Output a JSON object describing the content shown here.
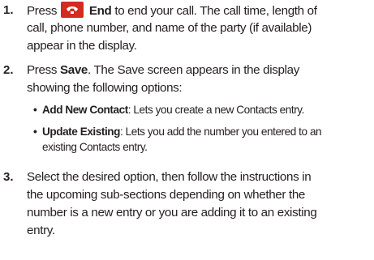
{
  "steps": [
    {
      "number": "1.",
      "icon": "end-call-icon",
      "line1_pre": "Press",
      "line1_bold": "End",
      "line1_post": "to end your call. The call time, length of",
      "line2": "call, phone number, and name of the party (if available)",
      "line3": "appear in the display."
    },
    {
      "number": "2.",
      "line1_pre": "Press",
      "line1_bold": "Save",
      "line1_post": ". The Save screen appears in the display",
      "line2": "showing the following options:"
    },
    {
      "number": "3.",
      "line1": "Select the desired option, then follow the instructions in",
      "line2": "the upcoming sub-sections depending on whether the",
      "line3": "number is a new entry or you are adding it to an existing",
      "line4": "entry."
    }
  ],
  "options": [
    {
      "bullet": "•",
      "title": "Add New Contact",
      "desc": ": Lets you create a new Contacts entry."
    },
    {
      "bullet": "•",
      "title": "Update Existing",
      "desc_line1": ": Lets you add the number you entered to an",
      "desc_line2": "existing Contacts entry."
    }
  ],
  "colors": {
    "text": "#231f20",
    "end_icon": "#d52a1e"
  }
}
